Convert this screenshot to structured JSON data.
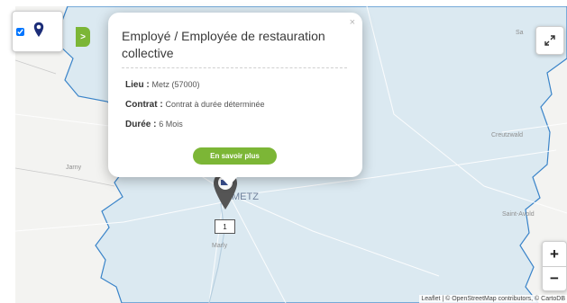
{
  "map": {
    "places": {
      "jarny": "Jarny",
      "metz": "METZ",
      "marly": "Marly",
      "creutzwald": "Creutzwald",
      "saint_avold": "Saint-Avold",
      "sa_partial": "Sa"
    },
    "marker_count": "1",
    "attribution": "Leaflet | © OpenStreetMap contributors, © CartoDB"
  },
  "controls": {
    "layer_checkbox_checked": true,
    "toggle_label": ">",
    "zoom_in": "+",
    "zoom_out": "−"
  },
  "popup": {
    "close": "×",
    "title": "Employé / Employée de restauration collective",
    "lieu_label": "Lieu :",
    "lieu_value": "Metz (57000)",
    "contrat_label": "Contrat :",
    "contrat_value": "Contrat à durée déterminée",
    "duree_label": "Durée :",
    "duree_value": "6 Mois",
    "button": "En savoir plus"
  },
  "colors": {
    "region_fill": "#dbe9f1",
    "border_blue": "#3a84c9",
    "accent_green": "#7cb636",
    "marker": "#555555"
  }
}
